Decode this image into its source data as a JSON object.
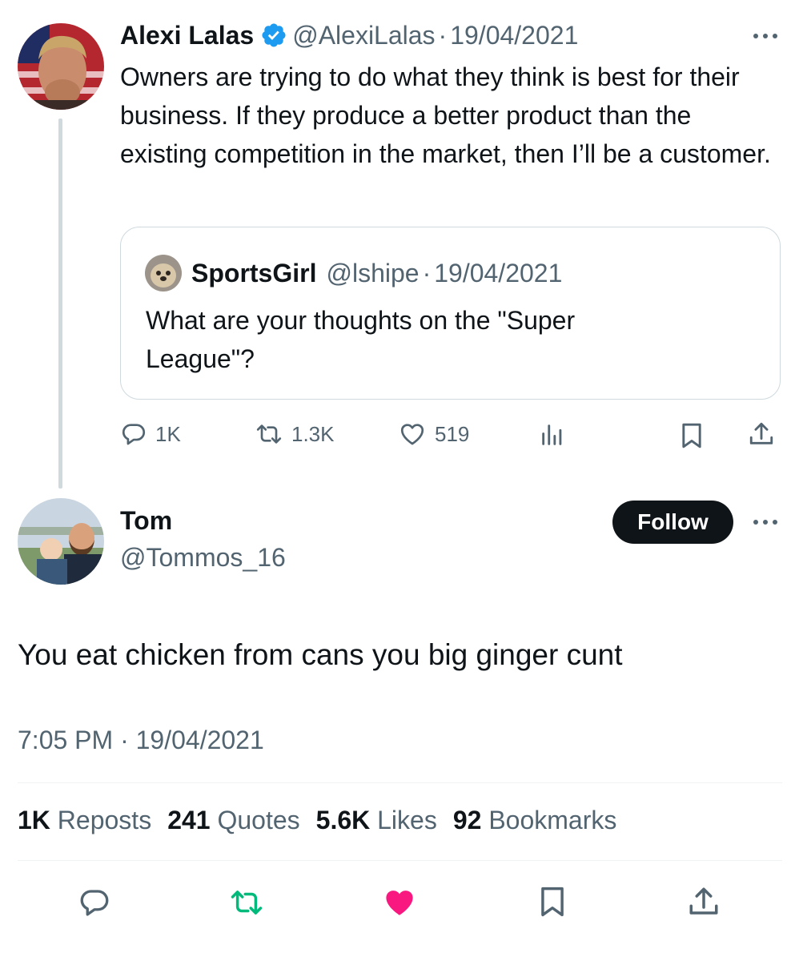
{
  "parent": {
    "name": "Alexi Lalas",
    "handle": "@AlexiLalas",
    "date": "19/04/2021",
    "dot": "·",
    "text": "Owners are trying to do what they think is best for their business. If they produce a better product than the existing competition in the market, then I’ll be a customer.",
    "quote": {
      "name": "SportsGirl",
      "handle": "@lshipe",
      "date": "19/04/2021",
      "text": "What are your thoughts on the \"Super League\"?"
    },
    "actions": {
      "replies": "1K",
      "reposts": "1.3K",
      "likes": "519"
    }
  },
  "reply": {
    "name": "Tom",
    "handle": "@Tommos_16",
    "follow_label": "Follow",
    "text": "You eat chicken from cans you big ginger cunt",
    "timestamp": "7:05 PM · 19/04/2021",
    "stats": {
      "reposts_count": "1K",
      "reposts_label": "Reposts",
      "quotes_count": "241",
      "quotes_label": "Quotes",
      "likes_count": "5.6K",
      "likes_label": "Likes",
      "bookmarks_count": "92",
      "bookmarks_label": "Bookmarks"
    }
  },
  "icons": {
    "verified": "verified-badge-icon",
    "more": "more-icon",
    "reply": "reply-icon",
    "repost": "repost-icon",
    "like": "heart-icon",
    "views": "analytics-icon",
    "bookmark": "bookmark-icon",
    "share": "share-icon"
  },
  "colors": {
    "verified": "#1d9bf0",
    "repost_active": "#00ba7c",
    "like_active": "#f91880",
    "text": "#0f1419",
    "muted": "#536471",
    "follow_bg": "#0f1419"
  }
}
